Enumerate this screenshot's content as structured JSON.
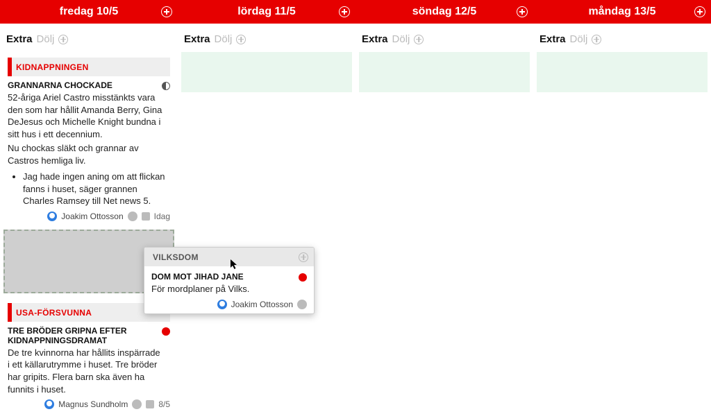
{
  "days": [
    {
      "label": "fredag 10/5"
    },
    {
      "label": "lördag 11/5"
    },
    {
      "label": "söndag 12/5"
    },
    {
      "label": "måndag 13/5"
    }
  ],
  "extra": {
    "label": "Extra",
    "hide_label": "Dölj"
  },
  "col0": {
    "card1": {
      "category": "KIDNAPPNINGEN",
      "headline": "GRANNARNA CHOCKADE",
      "body_p1": "52-åriga Ariel Castro misstänkts vara den som har hållit Amanda Berry, Gina DeJesus och Michelle Knight bundna i sitt hus i ett decennium.",
      "body_p2": "Nu chockas släkt och grannar av Castros hemliga liv.",
      "quote": "Jag hade ingen aning om att flickan fanns i huset, säger grannen Charles Ramsey till Net news 5.",
      "author": "Joakim Ottosson",
      "date": "Idag"
    },
    "card2": {
      "category": "USA-FÖRSVUNNA",
      "headline": "TRE BRÖDER GRIPNA EFTER KIDNAPPNINGSDRAMAT",
      "body": "De tre kvinnorna har hållits inspärrade i ett källarutrymme i huset. Tre bröder har gripits. Flera barn ska även ha funnits i huset.",
      "author": "Magnus Sundholm",
      "date": "8/5"
    }
  },
  "floatcard": {
    "category": "VILKSDOM",
    "headline": "DOM MOT JIHAD JANE",
    "body": "För mordplaner på Vilks.",
    "author": "Joakim Ottosson"
  }
}
